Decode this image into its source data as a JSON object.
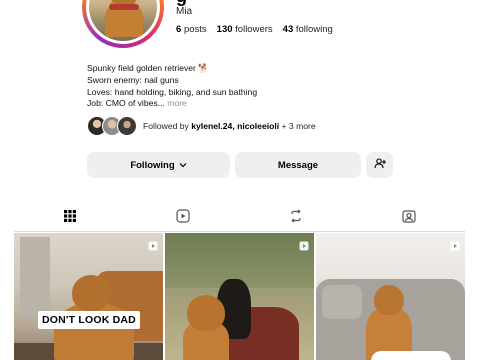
{
  "profile": {
    "username_fragment": "g",
    "name": "Mia",
    "stats": {
      "posts": "6",
      "posts_label": "posts",
      "followers": "130",
      "followers_label": "followers",
      "following": "43",
      "following_label": "following"
    },
    "bio": {
      "line1": "Spunky field golden retriever 🐕",
      "line2": "Sworn enemy: nail guns",
      "line3": "Loves: hand holding, biking, and sun bathing",
      "line4": "Job: CMO of vibes...",
      "more": "more"
    },
    "followed_by": {
      "prefix": "Followed by",
      "names": "kylenel.24, nicoleeioli",
      "suffix": "+ 3 more"
    }
  },
  "actions": {
    "following_label": "Following",
    "message_label": "Message"
  },
  "tabs": [
    {
      "icon": "grid-icon",
      "active": true
    },
    {
      "icon": "reels-icon",
      "active": false
    },
    {
      "icon": "repost-icon",
      "active": false
    },
    {
      "icon": "tagged-icon",
      "active": false
    }
  ],
  "posts": [
    {
      "caption": "DON'T LOOK DAD",
      "type": "reel"
    },
    {
      "caption": "",
      "type": "reel"
    },
    {
      "caption": "",
      "type": "reel"
    }
  ],
  "colors": {
    "button_bg": "#efefef",
    "ring_start": "#feda75",
    "ring_mid": "#d62976",
    "ring_end": "#962fbf",
    "muted_text": "#8e8e8e"
  }
}
